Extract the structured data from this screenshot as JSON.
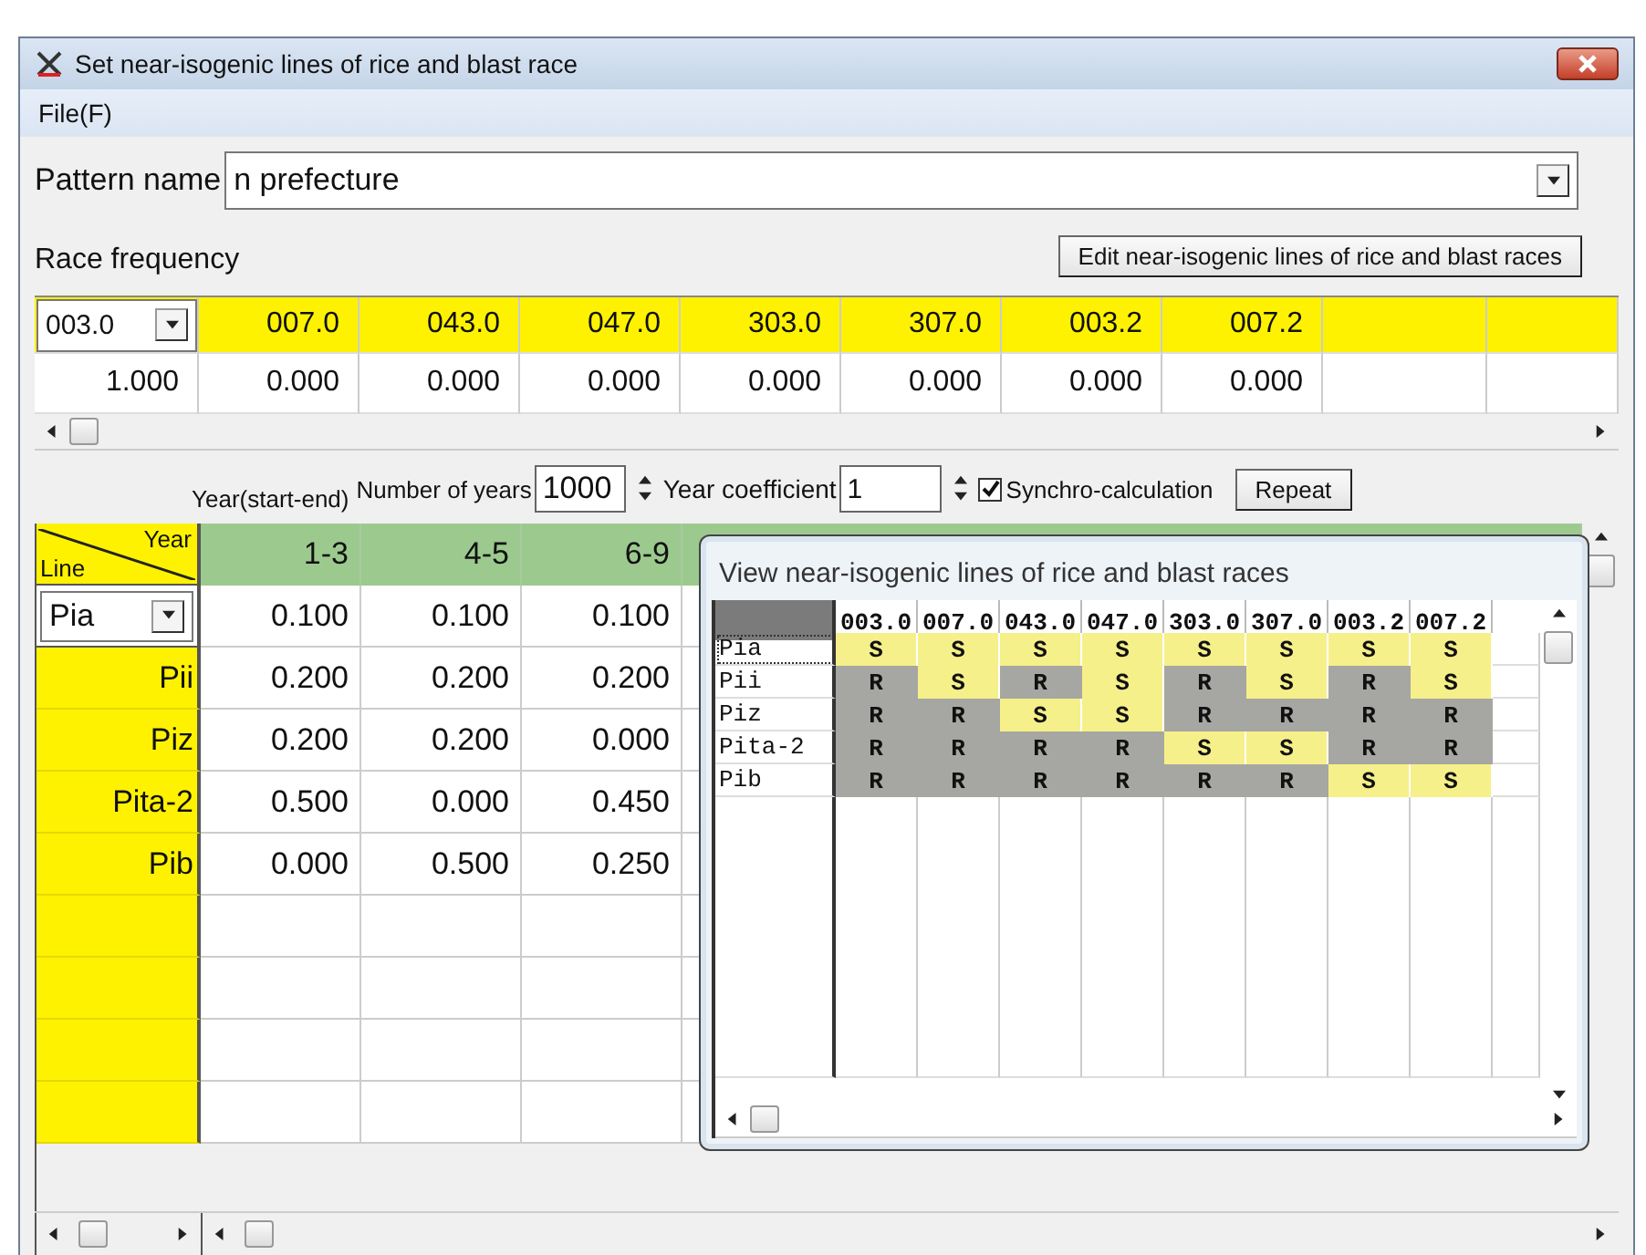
{
  "window": {
    "title": "Set near-isogenic lines of rice and blast race"
  },
  "menu": [
    "File(F)"
  ],
  "pattern": {
    "label": "Pattern name",
    "value": "n prefecture"
  },
  "race_frequency": {
    "label": "Race frequency",
    "edit_button": "Edit near-isogenic lines of rice and blast races",
    "selector": "003.0",
    "selector_value": "1.000",
    "races": [
      {
        "name": "007.0",
        "value": "0.000"
      },
      {
        "name": "043.0",
        "value": "0.000"
      },
      {
        "name": "047.0",
        "value": "0.000"
      },
      {
        "name": "303.0",
        "value": "0.000"
      },
      {
        "name": "307.0",
        "value": "0.000"
      },
      {
        "name": "003.2",
        "value": "0.000"
      },
      {
        "name": "007.2",
        "value": "0.000"
      }
    ]
  },
  "controls": {
    "year_range_label": "Year(start-end)",
    "years_label": "Number of years",
    "years_value": "1000",
    "coefficient_label": "Year coefficient",
    "coefficient_value": "1",
    "synchro": {
      "label": "Synchro-calculation",
      "checked": true
    },
    "repeat_button": "Repeat"
  },
  "year_table": {
    "corner_column": "Year",
    "corner_row": "Line",
    "columns": [
      "1-3",
      "4-5",
      "6-9"
    ],
    "rows": [
      {
        "kind": "selector",
        "line": "Pia",
        "values": [
          "0.100",
          "0.100",
          "0.100"
        ]
      },
      {
        "kind": "label",
        "line": "Pii",
        "values": [
          "0.200",
          "0.200",
          "0.200"
        ]
      },
      {
        "kind": "label",
        "line": "Piz",
        "values": [
          "0.200",
          "0.200",
          "0.000"
        ]
      },
      {
        "kind": "label",
        "line": "Pita-2",
        "values": [
          "0.500",
          "0.000",
          "0.450"
        ]
      },
      {
        "kind": "label",
        "line": "Pib",
        "values": [
          "0.000",
          "0.500",
          "0.250"
        ]
      }
    ]
  },
  "viewer": {
    "title": "View near-isogenic lines of rice and blast races",
    "columns": [
      "003.0",
      "007.0",
      "043.0",
      "047.0",
      "303.0",
      "307.0",
      "003.2",
      "007.2"
    ],
    "rows": [
      {
        "line": "Pia",
        "selected": true,
        "cells": [
          {
            "text": "S",
            "resistant": false
          },
          {
            "text": "S",
            "resistant": false
          },
          {
            "text": "S",
            "resistant": false
          },
          {
            "text": "S",
            "resistant": false
          },
          {
            "text": "S",
            "resistant": false
          },
          {
            "text": "S",
            "resistant": false
          },
          {
            "text": "S",
            "resistant": false
          },
          {
            "text": "S",
            "resistant": false
          }
        ]
      },
      {
        "line": "Pii",
        "selected": false,
        "cells": [
          {
            "text": "R",
            "resistant": true
          },
          {
            "text": "S",
            "resistant": false
          },
          {
            "text": "R",
            "resistant": true
          },
          {
            "text": "S",
            "resistant": false
          },
          {
            "text": "R",
            "resistant": true
          },
          {
            "text": "S",
            "resistant": false
          },
          {
            "text": "R",
            "resistant": true
          },
          {
            "text": "S",
            "resistant": false
          }
        ]
      },
      {
        "line": "Piz",
        "selected": false,
        "cells": [
          {
            "text": "R",
            "resistant": true
          },
          {
            "text": "R",
            "resistant": true
          },
          {
            "text": "S",
            "resistant": false
          },
          {
            "text": "S",
            "resistant": false
          },
          {
            "text": "R",
            "resistant": true
          },
          {
            "text": "R",
            "resistant": true
          },
          {
            "text": "R",
            "resistant": true
          },
          {
            "text": "R",
            "resistant": true
          }
        ]
      },
      {
        "line": "Pita-2",
        "selected": false,
        "cells": [
          {
            "text": "R",
            "resistant": true
          },
          {
            "text": "R",
            "resistant": true
          },
          {
            "text": "R",
            "resistant": true
          },
          {
            "text": "R",
            "resistant": true
          },
          {
            "text": "S",
            "resistant": false
          },
          {
            "text": "S",
            "resistant": false
          },
          {
            "text": "R",
            "resistant": true
          },
          {
            "text": "R",
            "resistant": true
          }
        ]
      },
      {
        "line": "Pib",
        "selected": false,
        "cells": [
          {
            "text": "R",
            "resistant": true
          },
          {
            "text": "R",
            "resistant": true
          },
          {
            "text": "R",
            "resistant": true
          },
          {
            "text": "R",
            "resistant": true
          },
          {
            "text": "R",
            "resistant": true
          },
          {
            "text": "R",
            "resistant": true
          },
          {
            "text": "S",
            "resistant": false
          },
          {
            "text": "S",
            "resistant": false
          }
        ]
      }
    ]
  }
}
